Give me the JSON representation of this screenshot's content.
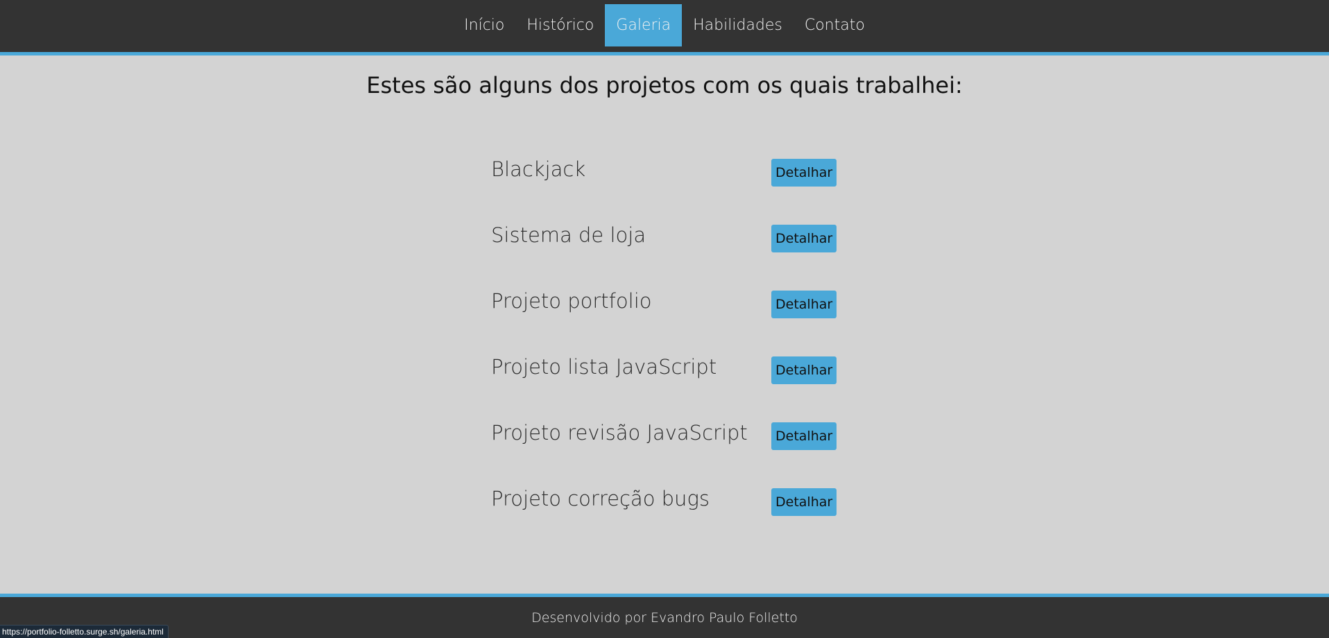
{
  "nav": {
    "items": [
      {
        "label": "Início",
        "active": false
      },
      {
        "label": "Histórico",
        "active": false
      },
      {
        "label": "Galeria",
        "active": true
      },
      {
        "label": "Habilidades",
        "active": false
      },
      {
        "label": "Contato",
        "active": false
      }
    ]
  },
  "main": {
    "heading": "Estes são alguns dos projetos com os quais trabalhei:",
    "projects": [
      {
        "name": "Blackjack",
        "button_label": "Detalhar"
      },
      {
        "name": "Sistema de loja",
        "button_label": "Detalhar"
      },
      {
        "name": "Projeto portfolio",
        "button_label": "Detalhar"
      },
      {
        "name": "Projeto lista JavaScript",
        "button_label": "Detalhar"
      },
      {
        "name": "Projeto revisão JavaScript",
        "button_label": "Detalhar"
      },
      {
        "name": "Projeto correção bugs",
        "button_label": "Detalhar"
      }
    ]
  },
  "footer": {
    "text": "Desenvolvido por Evandro Paulo Folletto"
  },
  "status_bar": {
    "url": "https://portfolio-folletto.surge.sh/galeria.html"
  },
  "colors": {
    "accent": "#4aa8d8",
    "nav_background": "#333333",
    "page_background": "#d3d3d3"
  }
}
